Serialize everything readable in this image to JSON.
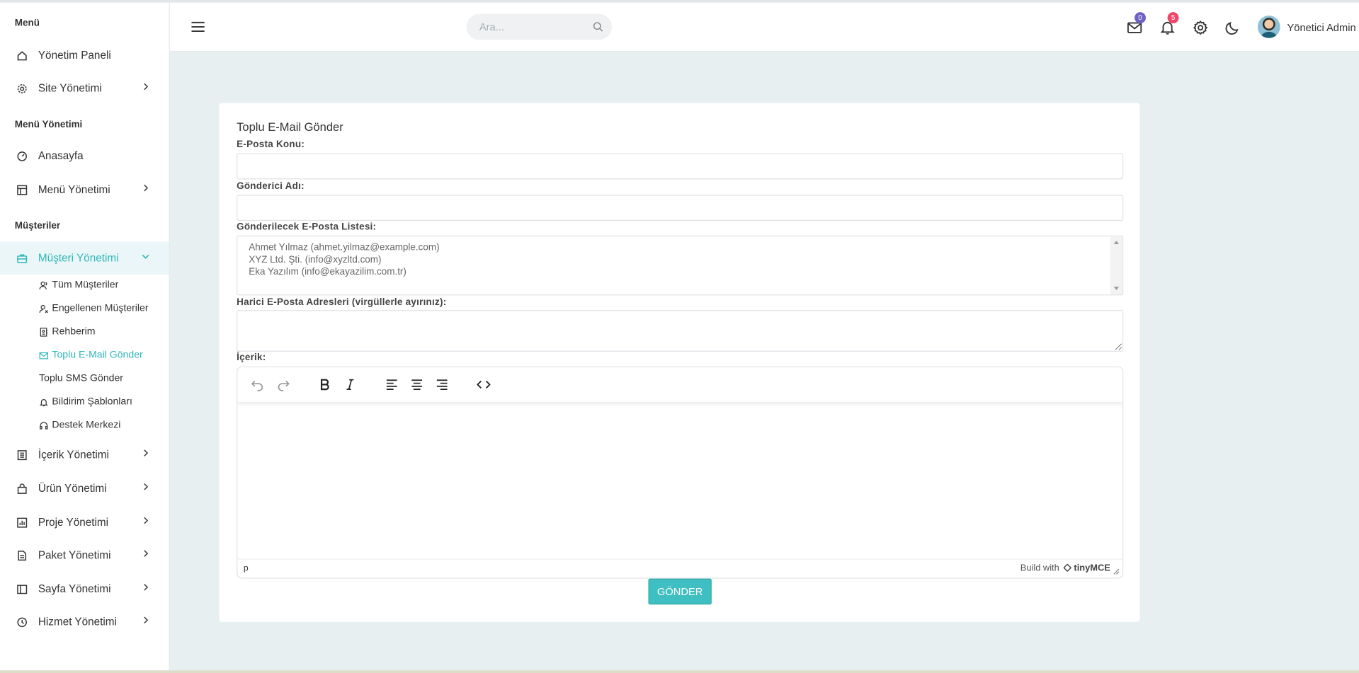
{
  "sidebar": {
    "sections": [
      "Menü",
      "Menü Yönetimi",
      "Müşteriler"
    ],
    "items": [
      {
        "label": "Yönetim Paneli",
        "icon": "home-icon"
      },
      {
        "label": "Site Yönetimi",
        "icon": "gear-icon"
      },
      {
        "label": "Anasayfa",
        "icon": "gauge-icon"
      },
      {
        "label": "Menü Yönetimi",
        "icon": "layout-icon"
      },
      {
        "label": "Müşteri Yönetimi",
        "icon": "briefcase-icon"
      },
      {
        "label": "İçerik Yönetimi",
        "icon": "document-list-icon"
      },
      {
        "label": "Ürün Yönetimi",
        "icon": "shopping-bag-icon"
      },
      {
        "label": "Proje Yönetimi",
        "icon": "bar-chart-icon"
      },
      {
        "label": "Paket Yönetimi",
        "icon": "file-icon"
      },
      {
        "label": "Sayfa Yönetimi",
        "icon": "sidebar-layout-icon"
      },
      {
        "label": "Hizmet Yönetimi",
        "icon": "clock-icon"
      }
    ],
    "subitems": [
      {
        "label": "Tüm Müşteriler",
        "icon": "users-icon"
      },
      {
        "label": "Engellenen Müşteriler",
        "icon": "user-x-icon"
      },
      {
        "label": "Rehberim",
        "icon": "contacts-book-icon"
      },
      {
        "label": "Toplu E-Mail Gönder",
        "icon": "mail-icon"
      },
      {
        "label": "Toplu SMS Gönder",
        "icon": ""
      },
      {
        "label": "Bildirim Şablonları",
        "icon": "bell-icon"
      },
      {
        "label": "Destek Merkezi",
        "icon": "headset-icon"
      }
    ]
  },
  "header": {
    "search_placeholder": "Ara...",
    "mail_count": "0",
    "notification_count": "5",
    "user_name": "Yönetici Admin"
  },
  "form": {
    "title": "Toplu E-Mail Gönder",
    "subject_label": "E-Posta Konu:",
    "sender_label": "Gönderici Adı:",
    "list_label": "Gönderilecek E-Posta Listesi:",
    "recipients": [
      "Ahmet Yılmaz (ahmet.yilmaz@example.com)",
      "XYZ Ltd. Şti. (info@xyzltd.com)",
      "Eka Yazılım (info@ekayazilim.com.tr)"
    ],
    "external_label": "Harici E-Posta Adresleri (virgüllerle ayırınız):",
    "content_label": "İçerik:",
    "editor_path": "p",
    "editor_brand_prefix": "Build with",
    "editor_brand": "tinyMCE",
    "submit_label": "GÖNDER"
  },
  "colors": {
    "accent": "#2fb7b9",
    "button": "#3fbfc1",
    "mail_badge": "#6e62c6",
    "notification_badge": "#f0466a",
    "page_background": "#e7eff0"
  }
}
